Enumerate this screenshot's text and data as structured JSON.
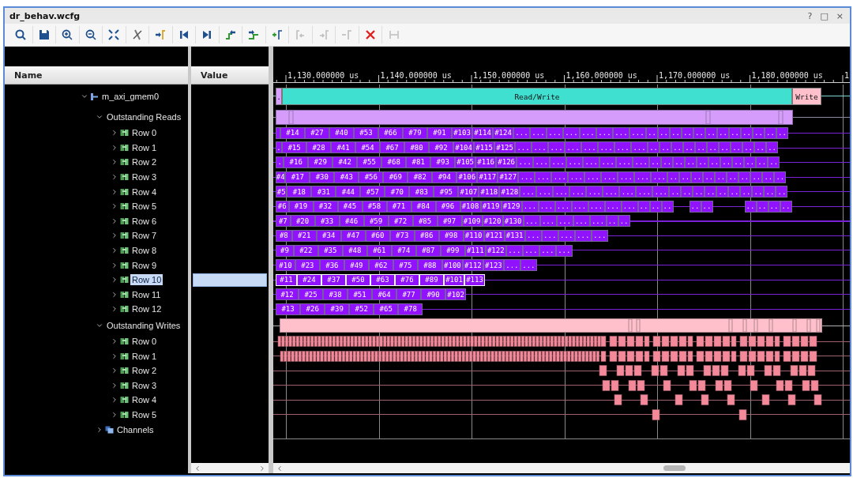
{
  "window": {
    "title": "dr_behav.wcfg",
    "controls": [
      "?",
      "□",
      "×"
    ]
  },
  "toolbar": [
    {
      "disabled": false
    },
    {
      "disabled": false
    },
    {
      "disabled": false
    },
    {
      "disabled": false
    },
    {
      "disabled": false
    },
    {
      "disabled": false
    },
    {
      "disabled": false
    },
    {
      "disabled": false
    },
    {
      "disabled": false
    },
    {
      "disabled": false
    },
    {
      "disabled": false
    },
    {
      "disabled": false
    },
    {
      "disabled": true
    },
    {
      "disabled": true
    },
    {
      "disabled": true
    },
    {
      "disabled": false
    },
    {
      "disabled": true
    }
  ],
  "columns": {
    "name": "Name",
    "value": "Value"
  },
  "timeline": {
    "ticks": [
      "1,130.000000 us",
      "1,140.000000 us",
      "1,150.000000 us",
      "1,160.000000 us",
      "1,170.000000 us",
      "1,180.000000 us",
      "1"
    ]
  },
  "tree": [
    {
      "label": "m_axi_gmem0",
      "kind": "bus",
      "expanded": true,
      "wave": {
        "kind": "phase",
        "segments": [
          {
            "label": ".",
            "kind": "read"
          },
          {
            "label": "Read/Write",
            "kind": "read_write"
          },
          {
            "label": "Write",
            "kind": "write"
          }
        ]
      },
      "children": [
        {
          "label": "Outstanding Reads",
          "kind": "group",
          "expanded": true,
          "wave": {
            "kind": "read_summary"
          },
          "children": [
            {
              "label": "Row 0",
              "kind": "row",
              "expanded": false,
              "selected": false,
              "wave": {
                "kind": "reads",
                "segments": [
                  "#14",
                  "#27",
                  "#40",
                  "#53",
                  "#66",
                  "#79",
                  "#91",
                  "#103",
                  "#114",
                  "#124",
                  "...",
                  "...",
                  "...",
                  "...",
                  "...",
                  "...",
                  "...",
                  "...",
                  "..",
                  "..",
                  "..",
                  "..",
                  "..",
                  "..",
                  "..",
                  "..",
                  "..",
                  "..",
                  "..",
                  ".."
                ]
              }
            },
            {
              "label": "Row 1",
              "kind": "row",
              "expanded": false,
              "selected": false,
              "wave": {
                "kind": "reads",
                "lead": ".",
                "segments": [
                  "#15",
                  "#28",
                  "#41",
                  "#54",
                  "#67",
                  "#80",
                  "#92",
                  "#104",
                  "#115",
                  "#125",
                  "...",
                  "...",
                  "...",
                  "...",
                  "...",
                  "...",
                  "...",
                  "...",
                  "..",
                  "..",
                  "..",
                  "..",
                  "..",
                  "..",
                  "..",
                  "..",
                  "..",
                  "..",
                  ".."
                ]
              }
            },
            {
              "label": "Row 2",
              "kind": "row",
              "expanded": false,
              "selected": false,
              "wave": {
                "kind": "reads",
                "lead": ".",
                "segments": [
                  "#16",
                  "#29",
                  "#42",
                  "#55",
                  "#68",
                  "#81",
                  "#93",
                  "#105",
                  "#116",
                  "#126",
                  "...",
                  "...",
                  "...",
                  "...",
                  "...",
                  "...",
                  "...",
                  "...",
                  "..",
                  "..",
                  "..",
                  "..",
                  "..",
                  "..",
                  "..",
                  "..",
                  "..",
                  "..",
                  ".."
                ]
              }
            },
            {
              "label": "Row 3",
              "kind": "row",
              "expanded": false,
              "selected": false,
              "wave": {
                "kind": "reads",
                "lead": "#4",
                "segments": [
                  "#17",
                  "#30",
                  "#43",
                  "#56",
                  "#69",
                  "#82",
                  "#94",
                  "#106",
                  "#117",
                  "#127",
                  "...",
                  "...",
                  "...",
                  "...",
                  "...",
                  "...",
                  "...",
                  "...",
                  "...",
                  "..",
                  "..",
                  "..",
                  "..",
                  "..",
                  "..",
                  "..",
                  "..",
                  "..",
                  ".."
                ]
              }
            },
            {
              "label": "Row 4",
              "kind": "row",
              "expanded": false,
              "selected": false,
              "wave": {
                "kind": "reads",
                "lead": "#5",
                "segments": [
                  "#18",
                  "#31",
                  "#44",
                  "#57",
                  "#70",
                  "#83",
                  "#95",
                  "#107",
                  "#118",
                  "#128",
                  "...",
                  "...",
                  "...",
                  "...",
                  "...",
                  "...",
                  "...",
                  "...",
                  "...",
                  "..",
                  "..",
                  "..",
                  "..",
                  "..",
                  "..",
                  "..",
                  "..",
                  "..",
                  ".."
                ]
              }
            },
            {
              "label": "Row 5",
              "kind": "row",
              "expanded": false,
              "selected": false,
              "wave": {
                "kind": "reads",
                "lead": "#6",
                "segments": [
                  "#19",
                  "#32",
                  "#45",
                  "#58",
                  "#71",
                  "#84",
                  "#96",
                  "#108",
                  "#119",
                  "#129",
                  "...",
                  "...",
                  "...",
                  "...",
                  "...",
                  "...",
                  "...",
                  "..",
                  "..",
                  "..",
                  {
                    "kind": "gap"
                  },
                  "..",
                  "..",
                  {
                    "kind": "gap"
                  },
                  {
                    "kind": "gap"
                  },
                  "..",
                  "..",
                  "..",
                  ".."
                ]
              }
            },
            {
              "label": "Row 6",
              "kind": "row",
              "expanded": false,
              "selected": false,
              "wave": {
                "kind": "reads",
                "lead": "#7",
                "segments": [
                  "#20",
                  "#33",
                  "#46",
                  "#59",
                  "#72",
                  "#85",
                  "#97",
                  "#109",
                  "#120",
                  "#130",
                  "...",
                  "...",
                  "...",
                  "...",
                  "...",
                  "..",
                  ".."
                ]
              }
            },
            {
              "label": "Row 7",
              "kind": "row",
              "expanded": false,
              "selected": false,
              "wave": {
                "kind": "reads",
                "lead": "#8",
                "segments": [
                  "#21",
                  "#34",
                  "#47",
                  "#60",
                  "#73",
                  "#86",
                  "#98",
                  "#110",
                  "#121",
                  "#131",
                  "...",
                  "...",
                  "...",
                  "...",
                  "..."
                ]
              }
            },
            {
              "label": "Row 8",
              "kind": "row",
              "expanded": false,
              "selected": false,
              "wave": {
                "kind": "reads",
                "lead": "#9",
                "segments": [
                  "#22",
                  "#35",
                  "#48",
                  "#61",
                  "#74",
                  "#87",
                  "#99",
                  "#111",
                  "#122",
                  "...",
                  "...",
                  "...",
                  "..."
                ]
              }
            },
            {
              "label": "Row 9",
              "kind": "row",
              "expanded": false,
              "selected": false,
              "wave": {
                "kind": "reads",
                "lead": "#10",
                "segments": [
                  "#23",
                  "#36",
                  "#49",
                  "#62",
                  "#75",
                  "#88",
                  "#100",
                  "#112",
                  "#123",
                  "...",
                  "..."
                ]
              }
            },
            {
              "label": "Row 10",
              "kind": "row",
              "expanded": false,
              "selected": true,
              "wave": {
                "kind": "reads",
                "lead": "#11",
                "segments": [
                  "#24",
                  "#37",
                  "#50",
                  "#63",
                  "#76",
                  "#89",
                  "#101",
                  "#113"
                ]
              }
            },
            {
              "label": "Row 11",
              "kind": "row",
              "expanded": false,
              "selected": false,
              "wave": {
                "kind": "reads",
                "lead": "#12",
                "segments": [
                  "#25",
                  "#38",
                  "#51",
                  "#64",
                  "#77",
                  "#90",
                  "#102"
                ]
              }
            },
            {
              "label": "Row 12",
              "kind": "row",
              "expanded": false,
              "selected": false,
              "wave": {
                "kind": "reads",
                "lead": "#13",
                "segments": [
                  "#26",
                  "#39",
                  "#52",
                  "#65",
                  "#78"
                ]
              }
            }
          ]
        },
        {
          "label": "Outstanding Writes",
          "kind": "group",
          "expanded": true,
          "wave": {
            "kind": "write_summary"
          },
          "children": [
            {
              "label": "Row 0",
              "kind": "row",
              "expanded": false,
              "selected": false,
              "wave": {
                "kind": "writes"
              }
            },
            {
              "label": "Row 1",
              "kind": "row",
              "expanded": false,
              "selected": false,
              "wave": {
                "kind": "writes"
              }
            },
            {
              "label": "Row 2",
              "kind": "row",
              "expanded": false,
              "selected": false,
              "wave": {
                "kind": "writes"
              }
            },
            {
              "label": "Row 3",
              "kind": "row",
              "expanded": false,
              "selected": false,
              "wave": {
                "kind": "writes"
              }
            },
            {
              "label": "Row 4",
              "kind": "row",
              "expanded": false,
              "selected": false,
              "wave": {
                "kind": "writes"
              }
            },
            {
              "label": "Row 5",
              "kind": "row",
              "expanded": false,
              "selected": false,
              "wave": {
                "kind": "writes"
              }
            }
          ]
        },
        {
          "label": "Channels",
          "kind": "channels",
          "expanded": false
        }
      ]
    }
  ]
}
